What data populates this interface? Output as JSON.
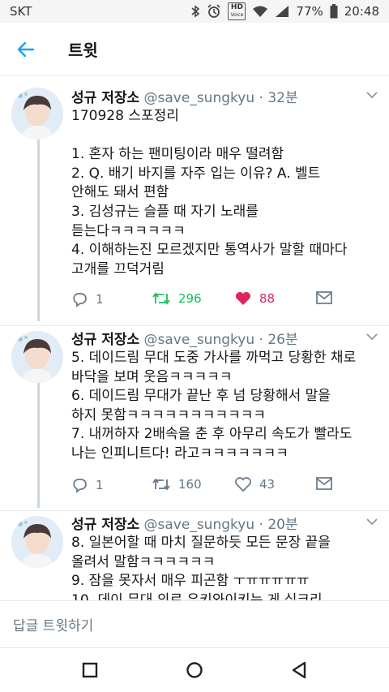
{
  "status_bar": {
    "carrier": "SKT",
    "hd_top": "HD",
    "hd_bottom": "Voice",
    "battery": "77%",
    "time": "20:48"
  },
  "header": {
    "title": "트윗"
  },
  "tweets": [
    {
      "name": "성규 저장소",
      "handle": "@save_sungkyu",
      "time": "· 32분",
      "lines": [
        "170928 스포정리",
        "",
        "1. 혼자 하는 팬미팅이라 매우 떨려함",
        "2. Q. 배기 바지를 자주 입는 이유? A. 벨트",
        "안해도 돼서 편함",
        "3. 김성규는 슬플 때 자기 노래를",
        "듣는다ㅋㅋㅋㅋㅋㅋ",
        "4. 이해하는진 모르겠지만 통역사가 말할 때마다",
        "고개를 끄덕거림"
      ],
      "replies": "1",
      "retweets": "296",
      "likes": "88",
      "retweeted": true,
      "liked": true
    },
    {
      "name": "성규 저장소",
      "handle": "@save_sungkyu",
      "time": "· 26분",
      "lines": [
        "5. 데이드림 무대 도중 가사를 까먹고 당황한 채로",
        "바닥을 보며 웃음ㅋㅋㅋㅋㅋ",
        "6. 데이드림 무대가 끝난 후 넘 당황해서 말을",
        "하지 못함ㅋㅋㅋㅋㅋㅋㅋㅋㅋㅋㅋ",
        "7. 내꺼하자 2배속을 춘 후 아무리 속도가 빨라도",
        "나는 인피니트다! 라고ㅋㅋㅋㅋㅋㅋㅋ"
      ],
      "replies": "1",
      "retweets": "160",
      "likes": "43",
      "retweeted": false,
      "liked": false
    },
    {
      "name": "성규 저장소",
      "handle": "@save_sungkyu",
      "time": "· 20분",
      "lines": [
        "8. 일본어할 때 마치 질문하듯 모든 문장 끝을",
        "올려서 말함ㅋㅋㅋㅋㅋㅋ",
        "9. 잠을 못자서 매우 피곤함 ㅜㅠㅠㅠㅠㅠ",
        "10. 데이 무대 의로 유키와이키는 게 심크리"
      ]
    }
  ],
  "reply_bar": {
    "placeholder": "답글 트윗하기"
  },
  "colors": {
    "accent": "#1da1f2",
    "retweet_green": "#17bf63",
    "like_red": "#e0245e",
    "muted": "#657786"
  }
}
